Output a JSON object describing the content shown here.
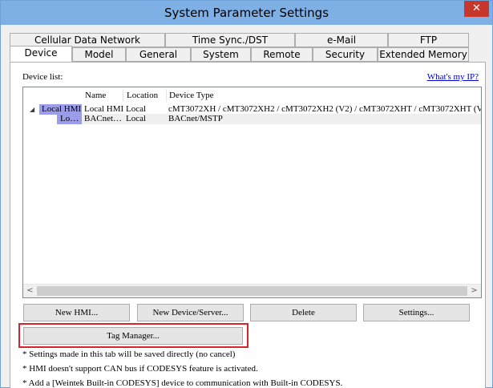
{
  "window": {
    "title": "System Parameter Settings",
    "close_glyph": "✕"
  },
  "tabs_row1": [
    "Cellular Data Network",
    "Time Sync./DST",
    "e-Mail",
    "FTP"
  ],
  "tabs_row2": [
    "Device",
    "Model",
    "General",
    "System",
    "Remote",
    "Security",
    "Extended Memory"
  ],
  "active_tab": "Device",
  "device_panel": {
    "device_list_label": "Device list:",
    "whats_my_ip_link": "What's my IP?",
    "columns": [
      "Name",
      "Location",
      "Device Type"
    ],
    "rows": [
      {
        "tree_toggle": "◢",
        "group": "Local HMI",
        "name": "Local HMI",
        "location": "Local",
        "device_type": "cMT3072XH / cMT3072XH2 / cMT3072XH2 (V2) / cMT3072XHT / cMT3072XHT (V2) ("
      },
      {
        "group": "Lo…",
        "name": "BACnet…",
        "location": "Local",
        "device_type": "BACnet/MSTP"
      }
    ],
    "scroll_left": "<",
    "scroll_right": ">"
  },
  "buttons": {
    "new_hmi": "New HMI...",
    "new_device": "New Device/Server...",
    "delete": "Delete",
    "settings": "Settings...",
    "tag_manager": "Tag Manager..."
  },
  "notes": [
    "* Settings made in this tab will be saved directly (no cancel)",
    "* HMI doesn't support CAN bus if CODESYS feature is activated.",
    "* Add a [Weintek Built-in CODESYS] device to communication with Built-in CODESYS."
  ],
  "colors": {
    "titlebar": "#7eb0e6",
    "close_button": "#c7372b",
    "hmi_tag": "#9c9ced",
    "highlight_border": "#d8232a"
  }
}
